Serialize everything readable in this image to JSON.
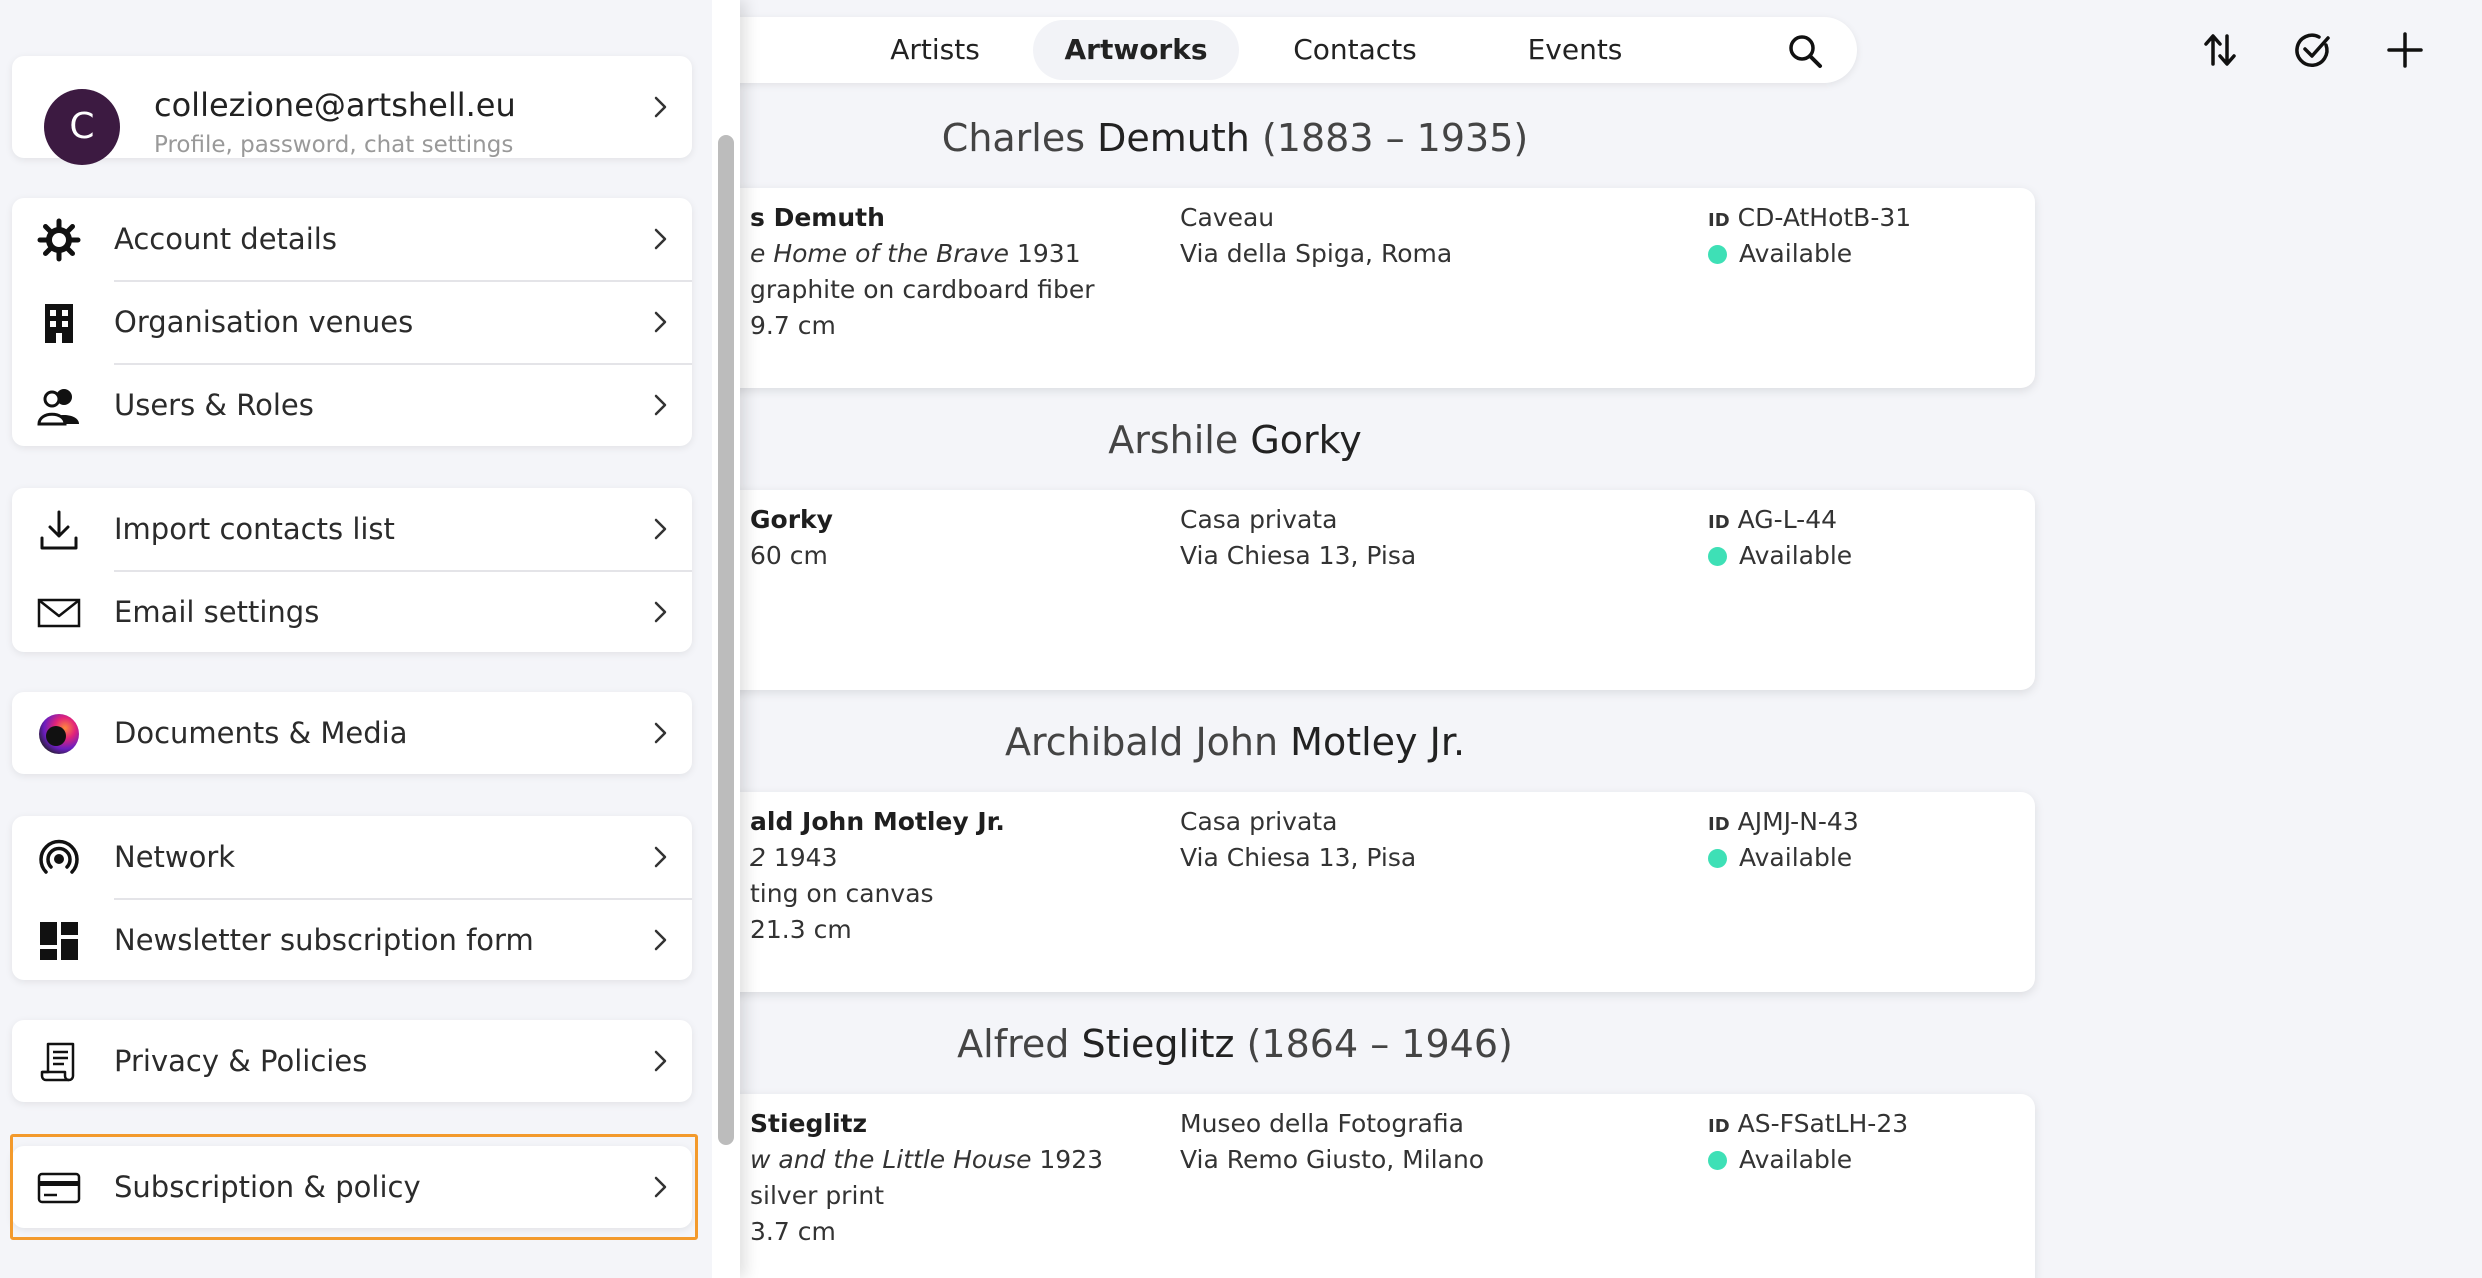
{
  "drawer": {
    "user": {
      "initial": "C",
      "email": "collezione@artshell.eu",
      "subtitle": "Profile, password, chat settings"
    },
    "items": {
      "account": "Account details",
      "venues": "Organisation venues",
      "users": "Users & Roles",
      "import": "Import contacts list",
      "email": "Email settings",
      "documents": "Documents & Media",
      "network": "Network",
      "newsletter": "Newsletter subscription form",
      "privacy": "Privacy & Policies",
      "subscription": "Subscription & policy"
    },
    "highlighted_item": "Subscription & policy"
  },
  "nav": {
    "tabs": [
      "Artists",
      "Artworks",
      "Contacts",
      "Events"
    ],
    "active_tab": "Artworks",
    "icons": [
      "search-icon",
      "sort-icon",
      "check-circle-icon",
      "plus-icon"
    ]
  },
  "artists": [
    {
      "first": "Charles",
      "last": "Demuth",
      "years": "(1883 – 1935)",
      "card_name": "s Demuth",
      "card_title_italic": "e Home of the Brave",
      "card_title_year": "1931",
      "card_medium": "graphite on cardboard fiber",
      "card_size": "9.7 cm",
      "venue": "Caveau",
      "address": "Via della Spiga, Roma",
      "id_label": "ID",
      "id": "CD-AtHotB-31",
      "status": "Available"
    },
    {
      "first": "Arshile",
      "last": "Gorky",
      "years": "",
      "card_name": "Gorky",
      "card_size": "60 cm",
      "venue": "Casa privata",
      "address": "Via Chiesa 13, Pisa",
      "id_label": "ID",
      "id": "AG-L-44",
      "status": "Available"
    },
    {
      "first": "Archibald John",
      "last": "Motley Jr.",
      "years": "",
      "card_name": "ald John Motley Jr.",
      "card_title_italic": "2",
      "card_title_year": "1943",
      "card_medium": "ting on canvas",
      "card_size": "21.3 cm",
      "venue": "Casa privata",
      "address": "Via Chiesa 13, Pisa",
      "id_label": "ID",
      "id": "AJMJ-N-43",
      "status": "Available"
    },
    {
      "first": "Alfred",
      "last": "Stieglitz",
      "years": "(1864 – 1946)",
      "card_name": "Stieglitz",
      "card_title_italic": "w and the Little House",
      "card_title_year": "1923",
      "card_medium": "silver print",
      "card_size": "3.7 cm",
      "venue": "Museo della Fotografia",
      "address": "Via Remo Giusto, Milano",
      "id_label": "ID",
      "id": "AS-FSatLH-23",
      "status": "Available"
    }
  ],
  "colors": {
    "accent_highlight": "#f39a2c",
    "status_available": "#3ee0b6",
    "avatar_bg": "#3c1a41"
  }
}
